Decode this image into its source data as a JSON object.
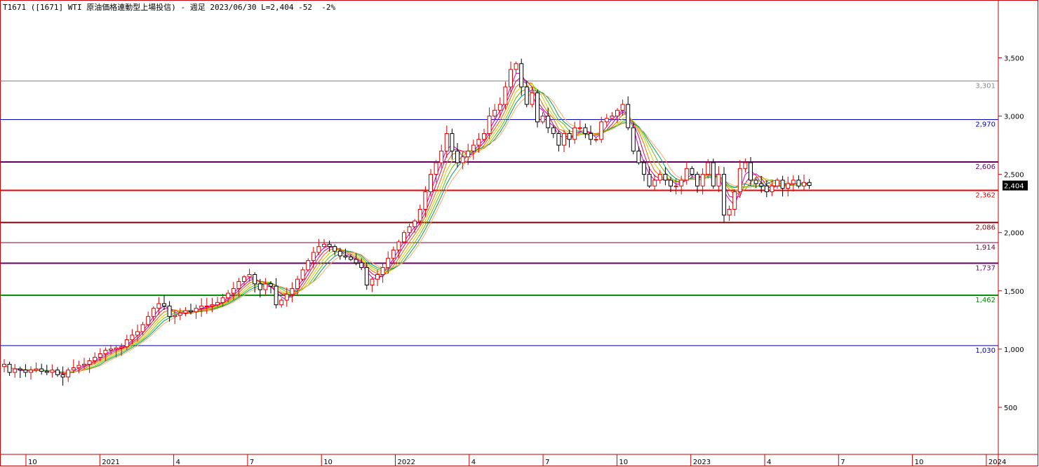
{
  "title": "T1671 ([1671] WTI 原油価格連動型上場投信) - 週足 2023/06/30 L=2,404 -52  -2%",
  "chart_data": {
    "type": "candlestick",
    "title": "T1671 ([1671] WTI 原油価格連動型上場投信) - 週足 2023/06/30 L=2,404 -52  -2%",
    "ylim": [
      0,
      3900
    ],
    "y_ticks": [
      500,
      1000,
      1500,
      2000,
      2500,
      3000,
      3500
    ],
    "y_tick_labels": [
      "500",
      "1,000",
      "1,500",
      "2,000",
      "2,500",
      "3,000",
      "3,500"
    ],
    "x_ticks": [
      {
        "label": "10",
        "date": "2020-10"
      },
      {
        "label": "2021",
        "date": "2021-01"
      },
      {
        "label": "4",
        "date": "2021-04"
      },
      {
        "label": "7",
        "date": "2021-07"
      },
      {
        "label": "10",
        "date": "2021-10"
      },
      {
        "label": "2022",
        "date": "2022-01"
      },
      {
        "label": "4",
        "date": "2022-04"
      },
      {
        "label": "7",
        "date": "2022-07"
      },
      {
        "label": "10",
        "date": "2022-10"
      },
      {
        "label": "2023",
        "date": "2023-01"
      },
      {
        "label": "4",
        "date": "2023-04"
      },
      {
        "label": "7",
        "date": "2023-07"
      },
      {
        "label": "10",
        "date": "2023-10"
      },
      {
        "label": "2024",
        "date": "2024-01"
      }
    ],
    "horizontal_lines": [
      {
        "value": 3301,
        "label": "3,301",
        "color": "#888888",
        "width": 1
      },
      {
        "value": 2970,
        "label": "2,970",
        "color": "#0000cc",
        "width": 1
      },
      {
        "value": 2606,
        "label": "2,606",
        "color": "#660066",
        "width": 2
      },
      {
        "value": 2362,
        "label": "2,362",
        "color": "#ee0000",
        "width": 2
      },
      {
        "value": 2086,
        "label": "2,086",
        "color": "#880000",
        "width": 2
      },
      {
        "value": 1914,
        "label": "1,914",
        "color": "#880033",
        "width": 1
      },
      {
        "value": 1737,
        "label": "1,737",
        "color": "#660066",
        "width": 2
      },
      {
        "value": 1462,
        "label": "1,462",
        "color": "#008800",
        "width": 2
      },
      {
        "value": 1030,
        "label": "1,030",
        "color": "#000099",
        "width": 1
      }
    ],
    "last_price": {
      "value": 2404,
      "label": "2,404"
    },
    "bull_color": "#dd0000",
    "bear_color": "#000000",
    "ribbon_colors": [
      "#cc00cc",
      "#dd0066",
      "#ee6600",
      "#cccc00",
      "#66bb00",
      "#009966",
      "#ffaa66"
    ],
    "closes": [
      870,
      800,
      830,
      820,
      800,
      820,
      830,
      810,
      800,
      820,
      780,
      760,
      820,
      840,
      860,
      870,
      900,
      930,
      960,
      990,
      1000,
      1010,
      1020,
      1080,
      1120,
      1150,
      1210,
      1280,
      1350,
      1390,
      1370,
      1280,
      1290,
      1310,
      1330,
      1320,
      1350,
      1370,
      1370,
      1380,
      1400,
      1440,
      1480,
      1520,
      1580,
      1620,
      1640,
      1560,
      1510,
      1560,
      1540,
      1380,
      1420,
      1470,
      1520,
      1600,
      1680,
      1760,
      1830,
      1880,
      1900,
      1880,
      1840,
      1800,
      1790,
      1770,
      1740,
      1700,
      1550,
      1600,
      1640,
      1700,
      1780,
      1850,
      1920,
      2000,
      2050,
      2100,
      2200,
      2350,
      2500,
      2600,
      2700,
      2850,
      2700,
      2600,
      2650,
      2700,
      2750,
      2800,
      2850,
      3000,
      3050,
      3100,
      3250,
      3400,
      3450,
      3250,
      3100,
      3200,
      2950,
      3000,
      2900,
      2850,
      2750,
      2850,
      2800,
      2900,
      2900,
      2850,
      2800,
      2800,
      2950,
      2980,
      3000,
      3050,
      3100,
      2900,
      2700,
      2600,
      2500,
      2400,
      2450,
      2500,
      2450,
      2400,
      2400,
      2450,
      2550,
      2500,
      2400,
      2500,
      2600,
      2400,
      2500,
      2150,
      2200,
      2350,
      2550,
      2600,
      2450,
      2420,
      2400,
      2350,
      2400,
      2450,
      2380,
      2420,
      2450,
      2400,
      2430,
      2404
    ]
  }
}
